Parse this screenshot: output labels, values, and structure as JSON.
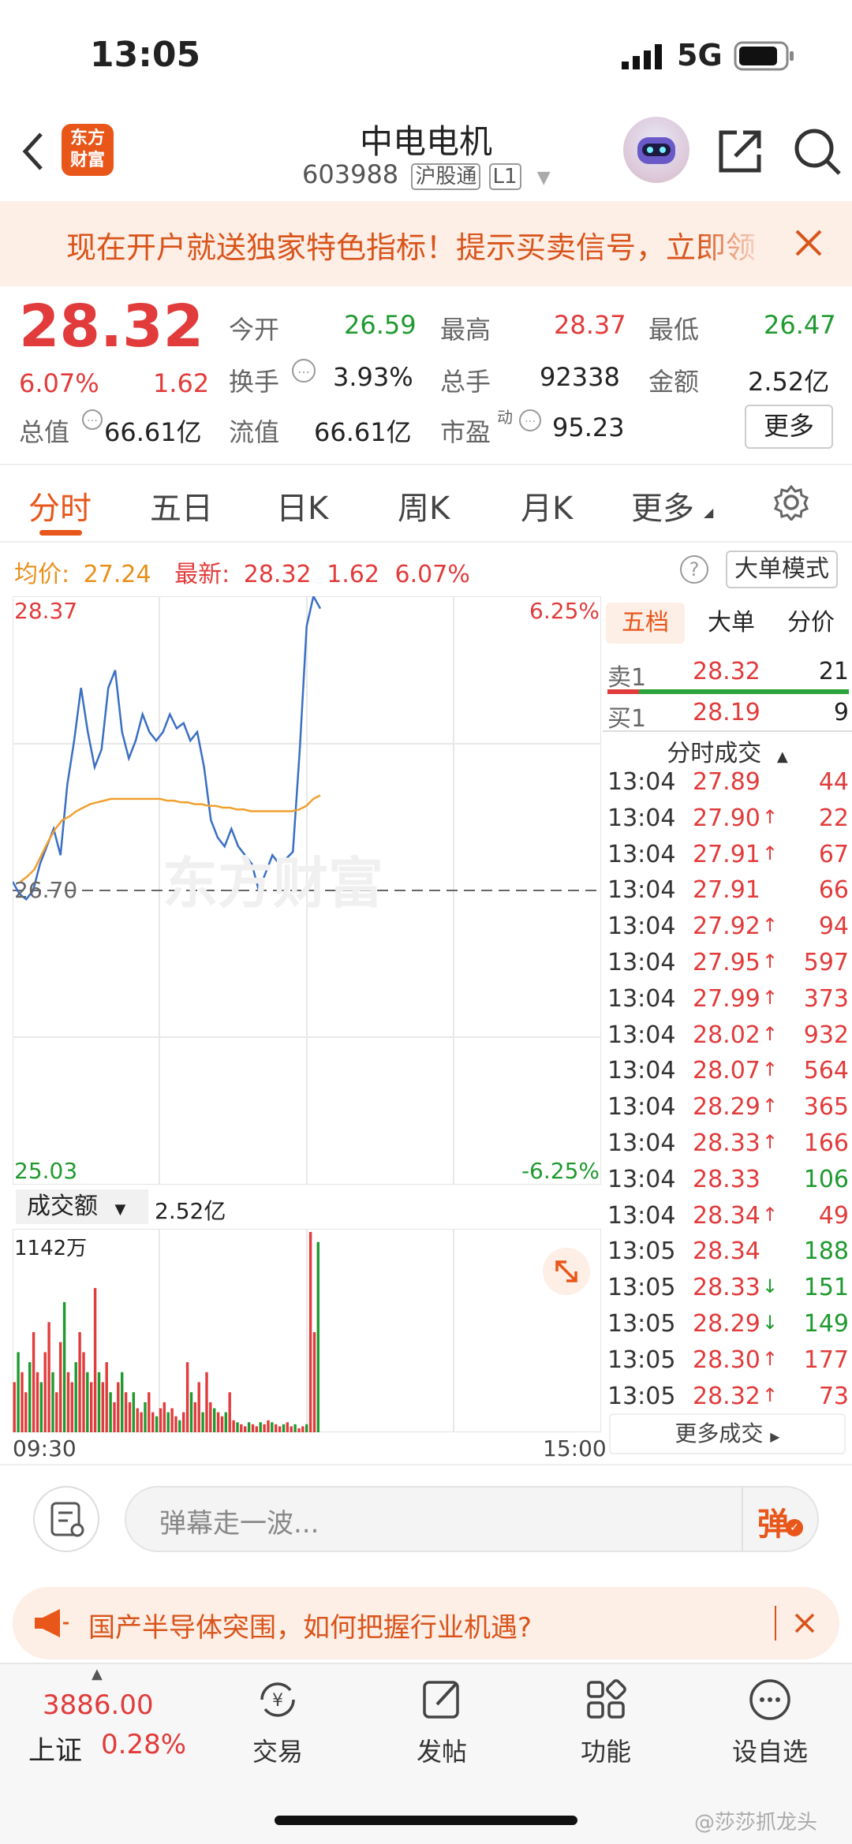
{
  "status": {
    "time": "13:05",
    "network": "5G"
  },
  "header": {
    "title": "中电电机",
    "code": "603988",
    "badge1": "沪股通",
    "badge2": "L1",
    "logo_line1": "东方",
    "logo_line2": "财富"
  },
  "banner": {
    "text": "现在开户就送独家特色指标！提示买卖信号，立即领"
  },
  "quote": {
    "price": "28.32",
    "pct": "6.07%",
    "chg": "1.62",
    "open_label": "今开",
    "open": "26.59",
    "high_label": "最高",
    "high": "28.37",
    "low_label": "最低",
    "low": "26.47",
    "turn_label": "换手",
    "turn": "3.93%",
    "vol_label": "总手",
    "vol": "92338",
    "amt_label": "金额",
    "amt": "2.52亿",
    "mcap_label": "总值",
    "mcap": "66.61亿",
    "float_label": "流值",
    "float": "66.61亿",
    "pe_label": "市盈",
    "pe_sup": "动",
    "pe": "95.23",
    "more": "更多"
  },
  "tabs": [
    "分时",
    "五日",
    "日K",
    "周K",
    "月K",
    "更多"
  ],
  "chart_header": {
    "avg_label": "均价:",
    "avg": "27.24",
    "last_label": "最新:",
    "last": "28.32",
    "chg": "1.62",
    "pct": "6.07%",
    "mode": "大单模式"
  },
  "chart_data": {
    "type": "line",
    "y_top": "28.37",
    "y_mid": "26.70",
    "y_bot": "25.03",
    "pct_top": "6.25%",
    "pct_bot": "-6.25%",
    "x_start": "09:30",
    "x_end": "15:00",
    "ylim": [
      25.03,
      28.37
    ],
    "series": [
      {
        "values": [
          26.75,
          26.68,
          26.65,
          26.7,
          26.85,
          26.95,
          27.05,
          26.9,
          27.3,
          27.55,
          27.85,
          27.6,
          27.4,
          27.5,
          27.85,
          27.95,
          27.6,
          27.45,
          27.55,
          27.7,
          27.6,
          27.55,
          27.6,
          27.7,
          27.62,
          27.65,
          27.55,
          27.6,
          27.4,
          27.1,
          27.0,
          26.95,
          27.05,
          26.95,
          26.9,
          26.85,
          26.7,
          26.8,
          26.9,
          26.85,
          26.88,
          26.92,
          27.5,
          28.2,
          28.37,
          28.3
        ]
      },
      {
        "values": [
          26.75,
          26.78,
          26.82,
          26.9,
          26.98,
          27.05,
          27.1,
          27.12,
          27.15,
          27.17,
          27.19,
          27.2,
          27.21,
          27.22,
          27.22,
          27.22,
          27.22,
          27.22,
          27.22,
          27.22,
          27.22,
          27.21,
          27.21,
          27.2,
          27.2,
          27.19,
          27.19,
          27.18,
          27.18,
          27.17,
          27.17,
          27.16,
          27.16,
          27.15,
          27.15,
          27.15,
          27.15,
          27.15,
          27.15,
          27.15,
          27.16,
          27.18,
          27.22,
          27.24
        ]
      }
    ],
    "volume": {
      "label": "成交额",
      "total": "2.52亿",
      "max_label": "1142万",
      "bars": [
        0.25,
        0.4,
        0.3,
        0.2,
        0.35,
        0.5,
        0.3,
        0.25,
        0.4,
        0.55,
        0.3,
        0.2,
        0.45,
        0.65,
        0.3,
        0.25,
        0.35,
        0.5,
        0.4,
        0.3,
        0.25,
        0.72,
        0.3,
        0.25,
        0.35,
        0.2,
        0.15,
        0.25,
        0.3,
        0.2,
        0.15,
        0.2,
        0.12,
        0.1,
        0.15,
        0.2,
        0.1,
        0.08,
        0.12,
        0.15,
        0.1,
        0.12,
        0.08,
        0.06,
        0.1,
        0.35,
        0.2,
        0.15,
        0.25,
        0.1,
        0.3,
        0.15,
        0.12,
        0.1,
        0.08,
        0.1,
        0.2,
        0.06,
        0.05,
        0.04,
        0.03,
        0.05,
        0.04,
        0.03,
        0.05,
        0.04,
        0.06,
        0.05,
        0.04,
        0.03,
        0.04,
        0.05,
        0.03,
        0.04,
        0.02,
        0.03,
        0.04,
        1.0,
        0.5,
        0.95
      ]
    }
  },
  "side_tabs": [
    "五档",
    "大单",
    "分价"
  ],
  "orderbook": {
    "sell_label": "卖1",
    "sell_price": "28.32",
    "sell_qty": "21",
    "buy_label": "买1",
    "buy_price": "28.19",
    "buy_qty": "9"
  },
  "trades_title": "分时成交",
  "trades": [
    {
      "t": "13:04",
      "p": "27.89",
      "a": "",
      "q": "44",
      "c": "red"
    },
    {
      "t": "13:04",
      "p": "27.90",
      "a": "↑",
      "q": "22",
      "c": "red"
    },
    {
      "t": "13:04",
      "p": "27.91",
      "a": "↑",
      "q": "67",
      "c": "red"
    },
    {
      "t": "13:04",
      "p": "27.91",
      "a": "",
      "q": "66",
      "c": "red"
    },
    {
      "t": "13:04",
      "p": "27.92",
      "a": "↑",
      "q": "94",
      "c": "red"
    },
    {
      "t": "13:04",
      "p": "27.95",
      "a": "↑",
      "q": "597",
      "c": "red"
    },
    {
      "t": "13:04",
      "p": "27.99",
      "a": "↑",
      "q": "373",
      "c": "red"
    },
    {
      "t": "13:04",
      "p": "28.02",
      "a": "↑",
      "q": "932",
      "c": "red"
    },
    {
      "t": "13:04",
      "p": "28.07",
      "a": "↑",
      "q": "564",
      "c": "red"
    },
    {
      "t": "13:04",
      "p": "28.29",
      "a": "↑",
      "q": "365",
      "c": "red"
    },
    {
      "t": "13:04",
      "p": "28.33",
      "a": "↑",
      "q": "166",
      "c": "red"
    },
    {
      "t": "13:04",
      "p": "28.33",
      "a": "",
      "q": "106",
      "c": "green"
    },
    {
      "t": "13:04",
      "p": "28.34",
      "a": "↑",
      "q": "49",
      "c": "red"
    },
    {
      "t": "13:05",
      "p": "28.34",
      "a": "",
      "q": "188",
      "c": "green"
    },
    {
      "t": "13:05",
      "p": "28.33",
      "a": "↓",
      "q": "151",
      "c": "green"
    },
    {
      "t": "13:05",
      "p": "28.29",
      "a": "↓",
      "q": "149",
      "c": "green"
    },
    {
      "t": "13:05",
      "p": "28.30",
      "a": "↑",
      "q": "177",
      "c": "red"
    },
    {
      "t": "13:05",
      "p": "28.32",
      "a": "↑",
      "q": "73",
      "c": "red"
    }
  ],
  "more_trades": "更多成交",
  "danmu": {
    "placeholder": "弹幕走一波...",
    "send": "弹"
  },
  "promo": {
    "text": "国产半导体突围，如何把握行业机遇?"
  },
  "bottom": {
    "index_value": "3886.00",
    "index_name": "上证",
    "index_pct": "0.28%",
    "items": [
      "交易",
      "发帖",
      "功能",
      "设自选"
    ]
  },
  "watermark": "@莎莎抓龙头",
  "colors": {
    "up": "#e23b3b",
    "down": "#1f9a2f",
    "accent": "#e8561a",
    "avg_line": "#f0a030",
    "price_line": "#3a6fc4"
  }
}
